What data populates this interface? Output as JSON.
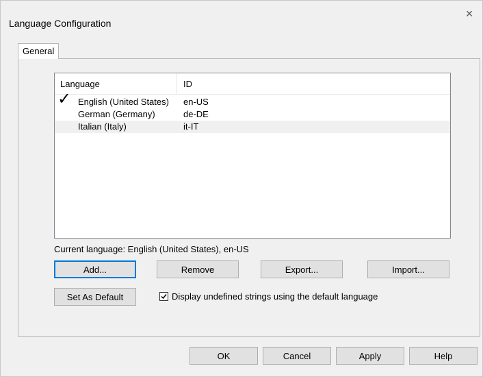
{
  "window": {
    "title": "Language Configuration",
    "close_glyph": "×"
  },
  "tabs": [
    {
      "label": "General"
    }
  ],
  "language_list": {
    "columns": [
      "Language",
      "ID"
    ],
    "rows": [
      {
        "name": "English (United States)",
        "id": "en-US",
        "checked": true,
        "selected": false
      },
      {
        "name": "German (Germany)",
        "id": "de-DE",
        "checked": false,
        "selected": false
      },
      {
        "name": "Italian (Italy)",
        "id": "it-IT",
        "checked": false,
        "selected": true
      }
    ]
  },
  "current_language_text": "Current language: English (United States), en-US",
  "buttons": {
    "add": "Add...",
    "remove": "Remove",
    "export": "Export...",
    "import": "Import...",
    "set_as_default": "Set As Default"
  },
  "display_undefined": {
    "label": "Display undefined strings using the default language",
    "checked": true
  },
  "footer_buttons": {
    "ok": "OK",
    "cancel": "Cancel",
    "apply": "Apply",
    "help": "Help"
  },
  "colors": {
    "default_button_border": "#0078d7",
    "selected_row": "#f0f0f0"
  },
  "icons": {
    "close": "close-icon",
    "check": "checkmark-icon",
    "checkbox": "checkbox-checked-icon"
  }
}
